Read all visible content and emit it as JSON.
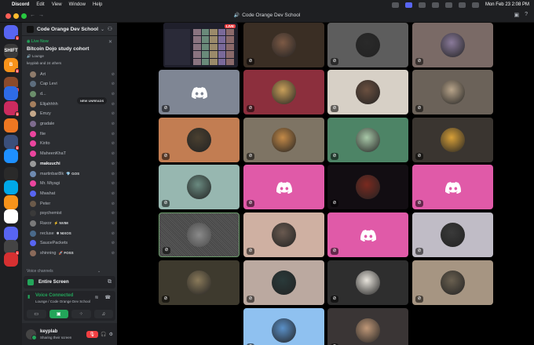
{
  "menubar": {
    "app_name": "Discord",
    "menus": [
      "Edit",
      "View",
      "Window",
      "Help"
    ],
    "clock": "Mon Feb 23  2:08 PM"
  },
  "window": {
    "title": "Code Orange Dev School"
  },
  "rail": {
    "servers": [
      {
        "color": "#5865f2",
        "label": "",
        "badge": "1"
      },
      {
        "color": "#3a3a3a",
        "label": "SHIFT",
        "badge": ""
      },
      {
        "color": "#f7931a",
        "label": "B",
        "badge": "6"
      },
      {
        "color": "#8b4a2b",
        "label": "",
        "badge": "1"
      },
      {
        "color": "#2e6be6",
        "label": "",
        "badge": ""
      },
      {
        "color": "#cc2b5e",
        "label": "",
        "badge": "3"
      },
      {
        "color": "#ee7722",
        "label": "",
        "badge": ""
      },
      {
        "color": "#3b4f7a",
        "label": "",
        "badge": "6"
      },
      {
        "color": "#1e90ff",
        "label": "",
        "badge": ""
      },
      {
        "color": "#2a2a2a",
        "label": "",
        "badge": ""
      },
      {
        "color": "#00a8e8",
        "label": "",
        "badge": ""
      },
      {
        "color": "#f7931a",
        "label": "",
        "badge": ""
      },
      {
        "color": "#ffffff",
        "label": "",
        "badge": ""
      },
      {
        "color": "#5865f2",
        "label": "",
        "badge": ""
      },
      {
        "color": "#444444",
        "label": "",
        "badge": "1"
      },
      {
        "color": "#d63031",
        "label": "",
        "badge": ""
      }
    ]
  },
  "sidebar": {
    "server_name": "Code Orange Dev School",
    "live": {
      "status": "Live Now",
      "event_title": "Bitcoin Dojo study cohort",
      "location": "Lounge",
      "attendees": "keyplab and 24 others"
    },
    "new_unreads": "NEW UNREADS",
    "members": [
      {
        "name": "Art",
        "color": "#8e7b6b",
        "bold": false,
        "tag": ""
      },
      {
        "name": "Cap Levi",
        "color": "#5d6d7e",
        "bold": false,
        "tag": ""
      },
      {
        "name": "d...",
        "color": "#6b8e6b",
        "bold": false,
        "tag": ""
      },
      {
        "name": "Elijahhhh",
        "color": "#a57f5e",
        "bold": false,
        "tag": ""
      },
      {
        "name": "Emzy",
        "color": "#c5a88a",
        "bold": false,
        "tag": ""
      },
      {
        "name": "gradale",
        "color": "#7e6b8e",
        "bold": false,
        "tag": ""
      },
      {
        "name": "fiie",
        "color": "#eb459e",
        "bold": false,
        "tag": ""
      },
      {
        "name": "Kirito",
        "color": "#eb459e",
        "bold": false,
        "tag": ""
      },
      {
        "name": "MaheenKhaT",
        "color": "#eb459e",
        "bold": false,
        "tag": ""
      },
      {
        "name": "makuuchi",
        "color": "#9a9a9a",
        "bold": true,
        "tag": ""
      },
      {
        "name": "martinbar8lk",
        "color": "#6e8ab0",
        "bold": false,
        "tag": "GOS"
      },
      {
        "name": "Mr. Miyagi",
        "color": "#eb459e",
        "bold": false,
        "tag": ""
      },
      {
        "name": "Mwahat",
        "color": "#5865f2",
        "bold": false,
        "tag": ""
      },
      {
        "name": "Peter",
        "color": "#6b5a4a",
        "bold": false,
        "tag": ""
      },
      {
        "name": "psychemist",
        "color": "#3a3a3a",
        "bold": false,
        "tag": ""
      },
      {
        "name": "Raxor",
        "color": "#7a7a7a",
        "bold": false,
        "tag": "NVIM"
      },
      {
        "name": "recluse",
        "color": "#4a6a8a",
        "bold": false,
        "tag": "NIXOS"
      },
      {
        "name": "SaucePackets",
        "color": "#5865f2",
        "bold": false,
        "tag": ""
      },
      {
        "name": "shinning",
        "color": "#8a6a5a",
        "bold": false,
        "tag": "FOSS"
      }
    ],
    "voice_channels_label": "Voice channels",
    "screen_share_label": "Entire Screen",
    "voice": {
      "status": "Voice Connected",
      "location": "Lounge / Code Orange Dev School"
    },
    "user": {
      "name": "keyplab",
      "status": "Sharing their screen"
    }
  },
  "stage": {
    "screen_share_badge": "LIVE",
    "tiles": [
      {
        "bg": "#3a2e24",
        "kind": "face",
        "face": "#7d5a45"
      },
      {
        "bg": "#5d5d5d",
        "kind": "face",
        "face": "#2a2a2a"
      },
      {
        "bg": "#7a6a66",
        "kind": "face",
        "face": "#8a7a9a"
      },
      {
        "bg": "#7f8694",
        "kind": "discord"
      },
      {
        "bg": "#8c2f3d",
        "kind": "face",
        "face": "#c9a05a"
      },
      {
        "bg": "#d7d0c6",
        "kind": "face",
        "face": "#6b5040"
      },
      {
        "bg": "#6b6259",
        "kind": "face",
        "face": "#b8a48a"
      },
      {
        "bg": "#c27d52",
        "kind": "face",
        "face": "#4a4030"
      },
      {
        "bg": "#7e7464",
        "kind": "face",
        "face": "#c48a48"
      },
      {
        "bg": "#4d8466",
        "kind": "face",
        "face": "#a8c8a8"
      },
      {
        "bg": "#3a3530",
        "kind": "face",
        "face": "#d8a038"
      },
      {
        "bg": "#97b7b0",
        "kind": "face",
        "face": "#6a8a80"
      },
      {
        "bg": "#e05aa8",
        "kind": "discord"
      },
      {
        "bg": "#120d12",
        "kind": "face",
        "face": "#7a2a20"
      },
      {
        "bg": "#e05aa8",
        "kind": "discord"
      },
      {
        "bg": "#4f4f4f",
        "kind": "noise"
      },
      {
        "bg": "#cfb0a2",
        "kind": "face",
        "face": "#6a5a50"
      },
      {
        "bg": "#e05aa8",
        "kind": "discord"
      },
      {
        "bg": "#c0bcc6",
        "kind": "face",
        "face": "#3a3a3a"
      },
      {
        "bg": "#3e3a2e",
        "kind": "face",
        "face": "#8a7a5a"
      },
      {
        "bg": "#bba9a0",
        "kind": "face",
        "face": "#2a3a3a"
      },
      {
        "bg": "#2e2e2e",
        "kind": "face",
        "face": "#e8e4dc"
      },
      {
        "bg": "#a69582",
        "kind": "face",
        "face": "#6a6050"
      },
      {
        "bg": "#8fc1f0",
        "kind": "face",
        "face": "#5a90c8"
      },
      {
        "bg": "#3a3535",
        "kind": "face",
        "face": "#c09878"
      }
    ]
  }
}
